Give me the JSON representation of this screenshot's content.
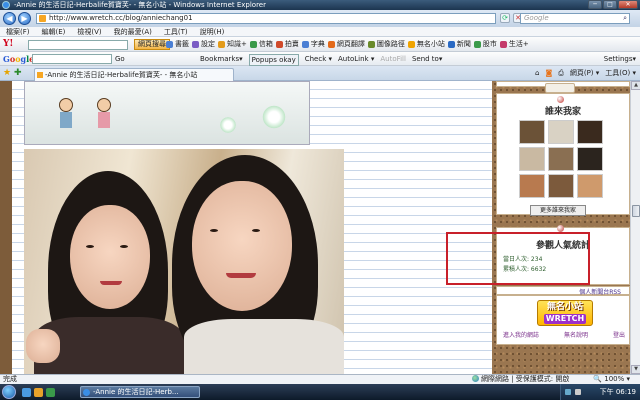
{
  "window": {
    "title": "-Annie 的生活日記-Herbalife賀寶芙- - 無名小站 - Windows Internet Explorer",
    "minimize": "─",
    "maximize": "□",
    "close": "✕"
  },
  "address": {
    "url": "http://www.wretch.cc/blog/anniechang01",
    "search_placeholder": "Google"
  },
  "menu": [
    "檔案(F)",
    "編輯(E)",
    "檢視(V)",
    "我的最愛(A)",
    "工具(T)",
    "說明(H)"
  ],
  "yahoo_bar": {
    "logo": "Y!",
    "search_button": "網頁搜尋",
    "tools": [
      {
        "label": "書籤",
        "color": "#4a7fd4"
      },
      {
        "label": "設定",
        "color": "#7a5cc4"
      },
      {
        "label": "知識+",
        "color": "#e39b1a"
      },
      {
        "label": "信箱",
        "color": "#3a9a4a"
      },
      {
        "label": "拍賣",
        "color": "#d04a2a"
      },
      {
        "label": "字典",
        "color": "#4a7fd4"
      },
      {
        "label": "網頁翻譯",
        "color": "#e36a1a"
      },
      {
        "label": "圖像路徑",
        "color": "#6a8a2a"
      },
      {
        "label": "無名小站",
        "color": "#f0a400"
      },
      {
        "label": "新聞",
        "color": "#2a6ac4"
      },
      {
        "label": "股市",
        "color": "#3a9a4a"
      },
      {
        "label": "生活+",
        "color": "#c43a6a"
      }
    ]
  },
  "google_bar": {
    "logo": "Google",
    "go": "Go",
    "tools": [
      {
        "label": "Bookmarks▾",
        "style": ""
      },
      {
        "label": "Popups okay",
        "style": "box"
      },
      {
        "label": "Check ▾",
        "style": ""
      },
      {
        "label": "AutoLink ▾",
        "style": ""
      },
      {
        "label": "AutoFill",
        "style": "dim"
      },
      {
        "label": "Send to▾",
        "style": ""
      }
    ],
    "settings": "Settings▾"
  },
  "tab": {
    "label": "-Annie 的生活日記-Herbalife賀寶芙- - 無名小站"
  },
  "command_bar": {
    "page": "網頁(P) ▾",
    "tools": "工具(O) ▾"
  },
  "sidebar": {
    "visitors_title": "誰來我家",
    "visitor_thumbs": [
      "#6b5237",
      "#d9d2c4",
      "#3a2a1e",
      "#c9b9a2",
      "#8a6f52",
      "#2b241e",
      "#b87a4f",
      "#7c5a3c",
      "#cf9a6c"
    ],
    "more_visitors": "更多誰來我家",
    "stats_title": "參觀人氣統計",
    "today_visits": "當日人次: 234",
    "total_visits": "累積人次: 6632",
    "rss": "個人新聞台RSS",
    "logo_cn": "無名小站",
    "logo_en": "WRETCH",
    "logo_links": [
      "進入我的網誌",
      "無名說明",
      "登出"
    ]
  },
  "status": {
    "text": "完成",
    "zone": "網際網路 | 受保護模式: 開啟",
    "zoom": "🔍 100% ▾"
  },
  "taskbar": {
    "ie_task": "-Annie 的生活日記-Herb...",
    "clock": "下午 06:19"
  }
}
